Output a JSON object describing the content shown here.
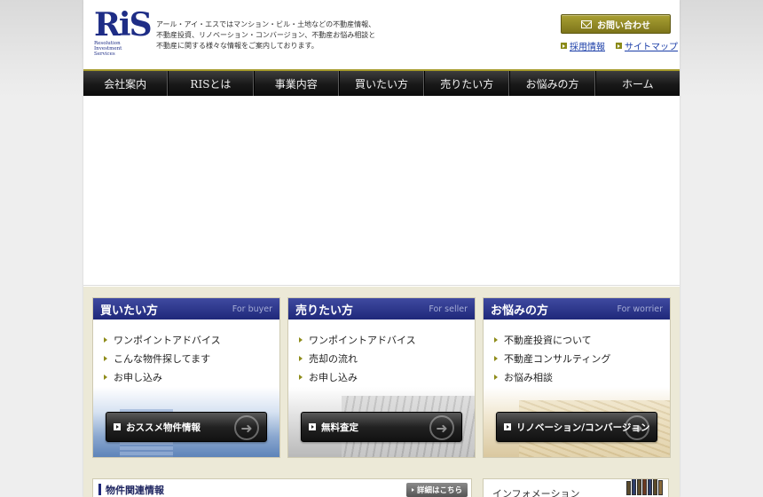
{
  "header": {
    "logo_text": "RiS",
    "logo_sub": [
      "Resolution",
      "Investment",
      "Services"
    ],
    "tagline": [
      "アール・アイ・エスではマンション・ビル・土地などの不動産情報、",
      "不動産投資、リノベーション・コンバージョン、不動産お悩み相談と",
      "不動産に関する様々な情報をご案内しております。"
    ],
    "contact_label": "お問い合わせ",
    "links": [
      {
        "label": "採用情報"
      },
      {
        "label": "サイトマップ"
      }
    ]
  },
  "nav": {
    "items": [
      "会社案内",
      "RISとは",
      "事業内容",
      "買いたい方",
      "売りたい方",
      "お悩みの方",
      "ホーム"
    ]
  },
  "cards": [
    {
      "title": "買いたい方",
      "en": "For buyer",
      "items": [
        "ワンポイントアドバイス",
        "こんな物件探してます",
        "お申し込み"
      ],
      "button": "おススメ物件情報"
    },
    {
      "title": "売りたい方",
      "en": "For seller",
      "items": [
        "ワンポイントアドバイス",
        "売却の流れ",
        "お申し込み"
      ],
      "button": "無料査定"
    },
    {
      "title": "お悩みの方",
      "en": "For worrier",
      "items": [
        "不動産投資について",
        "不動産コンサルティング",
        "お悩み相談"
      ],
      "button": "リノベーション/コンバージョン"
    }
  ],
  "bottom": {
    "property_title": "物件関連情報",
    "detail_label": "詳細はこちら",
    "info_title": "インフォメーション"
  },
  "colors": {
    "brand_navy": "#1e2d86",
    "accent_gold": "#a59a2b",
    "nav_dark": "#181818",
    "band_beige": "#ece9d7"
  }
}
